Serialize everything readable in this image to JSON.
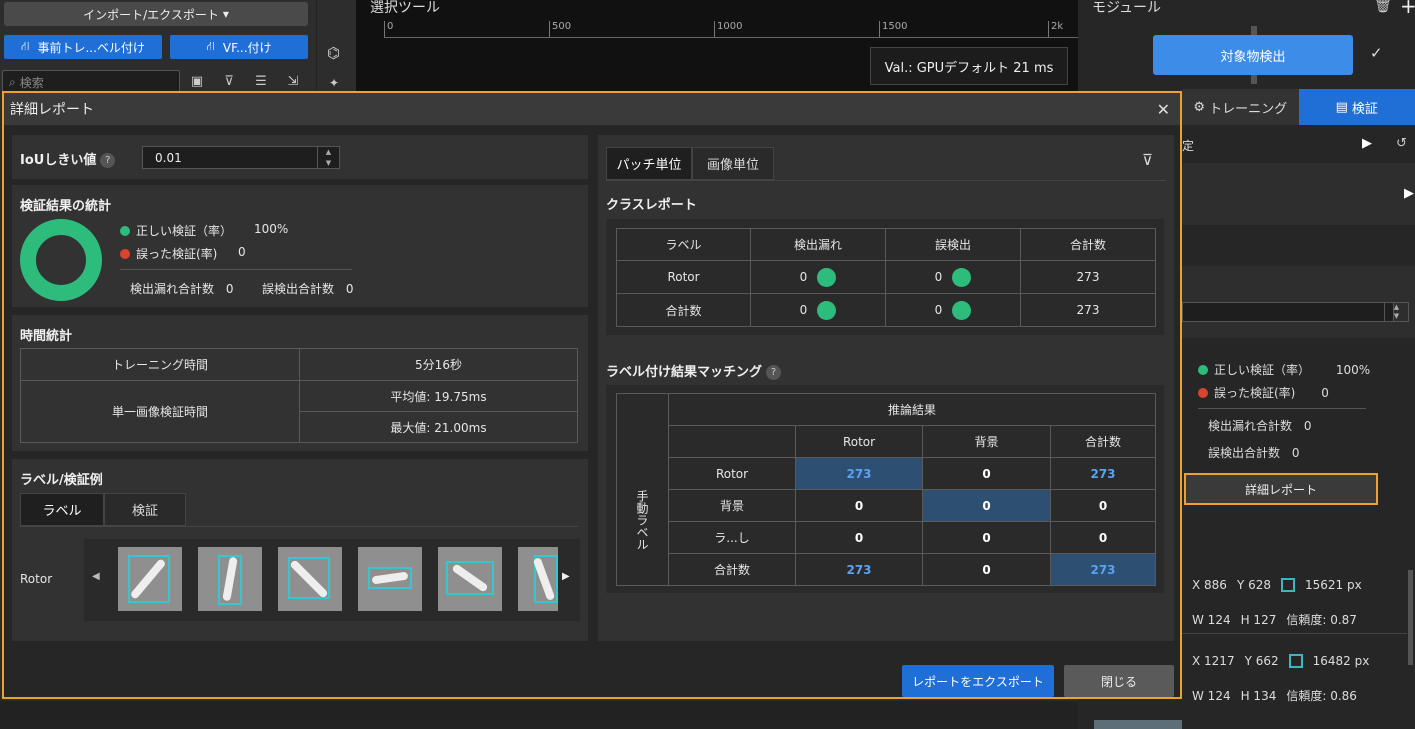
{
  "background": {
    "import_export": "インポート/エクスポート",
    "pre_label_btn": "事前トレ...ベル付け",
    "vf_btn": "VF...付け",
    "search_placeholder": "検索",
    "canvas_title": "選択ツール",
    "ruler_ticks": [
      "0",
      "500",
      "1000",
      "1500",
      "2k"
    ],
    "val_label": "Val.:  GPUデフォルト 21 ms",
    "module_title": "モジュール",
    "detect_btn": "対象物検出",
    "tab_training": "トレーニング",
    "tab_validate": "検証",
    "setting_fragment": "定",
    "correct": "正しい検証（率）",
    "correct_val": "100%",
    "wrong": "誤った検証(率)",
    "wrong_val": "0",
    "missed": "検出漏れ合計数",
    "missed_val": "0",
    "false_det": "誤検出合計数",
    "false_det_val": "0",
    "report_btn": "詳細レポート",
    "row1": {
      "x": "X 886",
      "y": "Y 628",
      "px": "15621 px",
      "w": "W 124",
      "h": "H 127",
      "conf": "信頼度: 0.87"
    },
    "row2": {
      "x": "X 1217",
      "y": "Y 662",
      "px": "16482 px",
      "w": "W 124",
      "h": "H 134",
      "conf": "信頼度: 0.86"
    }
  },
  "dialog": {
    "title": "詳細レポート",
    "iou_label": "IoUしきい値",
    "iou_value": "0.01",
    "stats_title": "検証結果の統計",
    "correct": "正しい検証（率）",
    "correct_val": "100%",
    "wrong": "誤った検証(率)",
    "wrong_val": "0",
    "missed": "検出漏れ合計数",
    "missed_val": "0",
    "false_det": "誤検出合計数",
    "false_det_val": "0",
    "time_title": "時間統計",
    "training_time_label": "トレーニング時間",
    "training_time_val": "5分16秒",
    "single_image_label": "単一画像検証時間",
    "avg": "平均値: 19.75ms",
    "max": "最大値: 21.00ms",
    "examples_title": "ラベル/検証例",
    "tab_label": "ラベル",
    "tab_validate": "検証",
    "row_class": "Rotor",
    "tab_patch": "パッチ単位",
    "tab_image": "画像単位",
    "class_report_title": "クラスレポート",
    "class_report": {
      "headers": [
        "ラベル",
        "検出漏れ",
        "誤検出",
        "合計数"
      ],
      "rows": [
        {
          "label": "Rotor",
          "missed": "0",
          "false": "0",
          "total": "273"
        },
        {
          "label": "合計数",
          "missed": "0",
          "false": "0",
          "total": "273"
        }
      ]
    },
    "matching_title": "ラベル付け結果マッチング",
    "matching": {
      "inference_header": "推論結果",
      "manual_label": "手動ラベル",
      "col_headers": [
        "Rotor",
        "背景",
        "合計数"
      ],
      "rows": [
        {
          "label": "Rotor",
          "values": [
            "273",
            "0",
            "273"
          ]
        },
        {
          "label": "背景",
          "values": [
            "0",
            "0",
            "0"
          ]
        },
        {
          "label": "ラ...し",
          "values": [
            "0",
            "0",
            "0"
          ]
        },
        {
          "label": "合計数",
          "values": [
            "273",
            "0",
            "273"
          ]
        }
      ]
    },
    "export_btn": "レポートをエクスポート",
    "close_btn": "閉じる"
  },
  "colors": {
    "accent": "#1f6fd6",
    "highlight": "#f0a030",
    "success": "#2ebc7c",
    "error": "#d9442f"
  }
}
